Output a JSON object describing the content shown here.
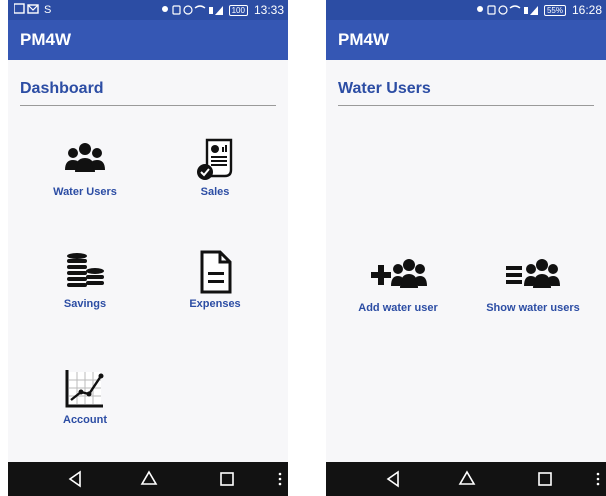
{
  "screens": [
    {
      "status": {
        "time": "13:33",
        "battery": "100"
      },
      "appbar": {
        "title": "PM4W"
      },
      "section": {
        "title": "Dashboard"
      },
      "tiles": [
        {
          "label": "Water Users",
          "icon": "users-icon"
        },
        {
          "label": "Sales",
          "icon": "sales-report-icon"
        },
        {
          "label": "Savings",
          "icon": "coins-stack-icon"
        },
        {
          "label": "Expenses",
          "icon": "document-icon"
        },
        {
          "label": "Account",
          "icon": "line-chart-icon"
        }
      ]
    },
    {
      "status": {
        "time": "16:28",
        "battery": "55%"
      },
      "appbar": {
        "title": "PM4W"
      },
      "section": {
        "title": "Water Users"
      },
      "actions": [
        {
          "label": "Add water user",
          "icon": "add-users-icon"
        },
        {
          "label": "Show water users",
          "icon": "list-users-icon"
        }
      ]
    }
  ],
  "navbar": {
    "icons": [
      "back-icon",
      "home-icon",
      "recents-icon",
      "overflow-menu-icon"
    ]
  },
  "colors": {
    "appbar": "#3557b4",
    "statusbar": "#2c4da4",
    "accent": "#2c4da4",
    "navbar": "#121212",
    "background": "#f7f7f9"
  }
}
